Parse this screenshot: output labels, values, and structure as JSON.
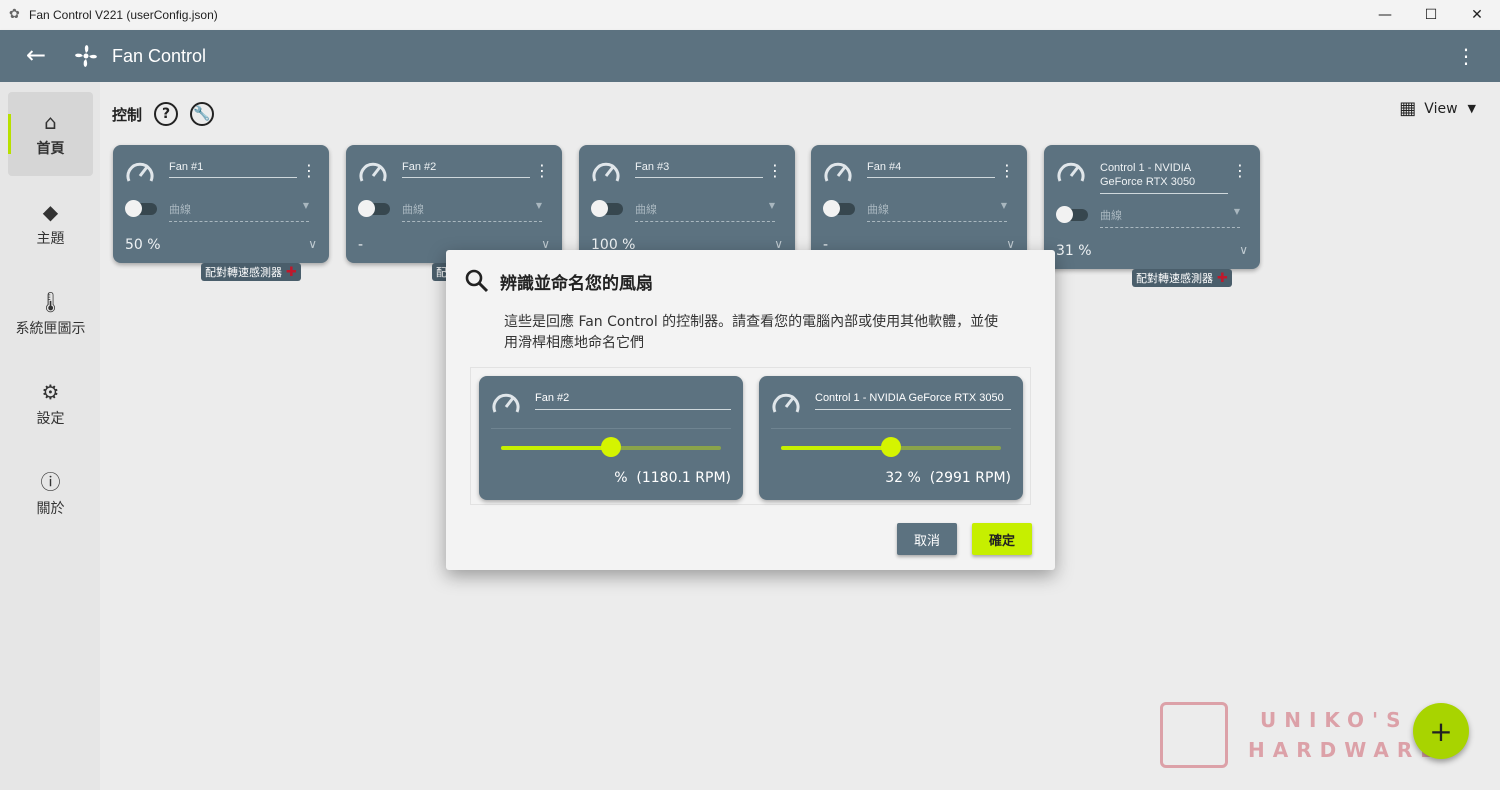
{
  "window": {
    "title": "Fan Control V221 (userConfig.json)",
    "minimize": "—",
    "maximize": "☐",
    "close": "✕"
  },
  "appbar": {
    "title": "Fan Control"
  },
  "sidebar": {
    "items": [
      {
        "label": "首頁",
        "icon": "home-icon",
        "active": true
      },
      {
        "label": "主題",
        "icon": "paint-bucket-icon"
      },
      {
        "label": "系統匣圖示",
        "icon": "thermometer-icon"
      },
      {
        "label": "設定",
        "icon": "gear-icon"
      },
      {
        "label": "關於",
        "icon": "info-icon"
      }
    ]
  },
  "controls": {
    "header": "控制",
    "help": "?",
    "view_label": "View",
    "cards": [
      {
        "name": "Fan #1",
        "curve": "曲線",
        "value": "50 %",
        "pair_tag": "配對轉速感測器"
      },
      {
        "name": "Fan #2",
        "curve": "曲線",
        "value": "-",
        "pair_tag": "配"
      },
      {
        "name": "Fan #3",
        "curve": "曲線",
        "value": "100 %"
      },
      {
        "name": "Fan #4",
        "curve": "曲線",
        "value": "-"
      },
      {
        "name": "Control 1 - NVIDIA GeForce RTX 3050",
        "curve": "曲線",
        "value": "31 %",
        "pair_tag": "配對轉速感測器"
      }
    ]
  },
  "dialog": {
    "title": "辨識並命名您的風扇",
    "description": "這些是回應 Fan Control 的控制器。請查看您的電腦內部或使用其他軟體，並使用滑桿相應地命名它們",
    "cards": [
      {
        "name": "Fan #2",
        "slider_percent": 50,
        "reading": "%  (1180.1 RPM)"
      },
      {
        "name": "Control 1 - NVIDIA GeForce RTX 3050",
        "slider_percent": 50,
        "reading": "32 %  (2991 RPM)"
      }
    ],
    "cancel_label": "取消",
    "ok_label": "確定"
  },
  "fab": {
    "label": "+"
  },
  "watermark": {
    "line1": "UNIKO'S",
    "line2": "HARDWARE"
  },
  "colors": {
    "accent": "#c6ef00",
    "card": "#5c7280",
    "appbar": "#5c7280"
  }
}
